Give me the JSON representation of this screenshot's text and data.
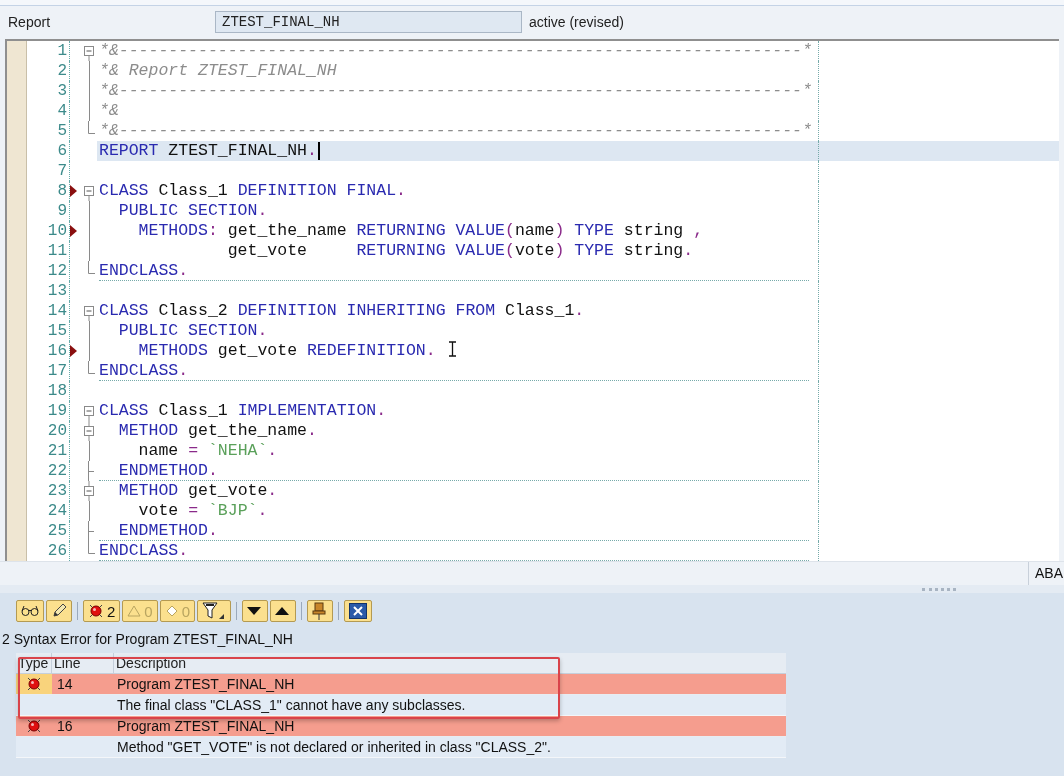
{
  "header": {
    "label": "Report",
    "program": "ZTEST_FINAL_NH",
    "status": "active (revised)"
  },
  "editor": {
    "lines": [
      {
        "number": "1",
        "kind": "open",
        "marker": false,
        "current": false,
        "rule": false,
        "tokens": [
          {
            "kind": "comment",
            "text": "*&---------------------------------------------------------------------*"
          }
        ]
      },
      {
        "number": "2",
        "kind": "line",
        "marker": false,
        "current": false,
        "rule": false,
        "tokens": [
          {
            "kind": "comment",
            "text": "*& Report ZTEST_FINAL_NH"
          }
        ]
      },
      {
        "number": "3",
        "kind": "line",
        "marker": false,
        "current": false,
        "rule": false,
        "tokens": [
          {
            "kind": "comment",
            "text": "*&---------------------------------------------------------------------*"
          }
        ]
      },
      {
        "number": "4",
        "kind": "line",
        "marker": false,
        "current": false,
        "rule": false,
        "tokens": [
          {
            "kind": "comment",
            "text": "*&"
          }
        ]
      },
      {
        "number": "5",
        "kind": "end",
        "marker": false,
        "current": false,
        "rule": false,
        "tokens": [
          {
            "kind": "comment",
            "text": "*&---------------------------------------------------------------------*"
          }
        ]
      },
      {
        "number": "6",
        "kind": "none",
        "marker": false,
        "current": true,
        "rule": false,
        "tokens": [
          {
            "kind": "keyword",
            "text": "REPORT"
          },
          {
            "kind": "ident",
            "text": " ZTEST_FINAL_NH"
          },
          {
            "kind": "punct",
            "text": "."
          }
        ]
      },
      {
        "number": "7",
        "kind": "none",
        "marker": false,
        "current": false,
        "rule": false
      },
      {
        "number": "8",
        "kind": "open",
        "marker": true,
        "current": false,
        "rule": false,
        "tokens": [
          {
            "kind": "keyword",
            "text": "CLASS"
          },
          {
            "kind": "ident",
            "text": " Class_1 "
          },
          {
            "kind": "keyword",
            "text": "DEFINITION FINAL"
          },
          {
            "kind": "punct",
            "text": "."
          }
        ]
      },
      {
        "number": "9",
        "kind": "line",
        "marker": false,
        "current": false,
        "rule": false,
        "tokens": [
          {
            "kind": "keyword",
            "text": "  PUBLIC SECTION"
          },
          {
            "kind": "punct",
            "text": "."
          }
        ]
      },
      {
        "number": "10",
        "kind": "line",
        "marker": true,
        "current": false,
        "rule": false,
        "tokens": [
          {
            "kind": "keyword",
            "text": "    METHODS"
          },
          {
            "kind": "punct",
            "text": ":"
          },
          {
            "kind": "ident",
            "text": " get_the_name "
          },
          {
            "kind": "keyword",
            "text": "RETURNING VALUE"
          },
          {
            "kind": "punct",
            "text": "("
          },
          {
            "kind": "ident",
            "text": "name"
          },
          {
            "kind": "punct",
            "text": ")"
          },
          {
            "kind": "keyword",
            "text": " TYPE"
          },
          {
            "kind": "ident",
            "text": " string "
          },
          {
            "kind": "punct",
            "text": ","
          }
        ]
      },
      {
        "number": "11",
        "kind": "line",
        "marker": false,
        "current": false,
        "rule": false,
        "tokens": [
          {
            "kind": "ident",
            "text": "             get_vote     "
          },
          {
            "kind": "keyword",
            "text": "RETURNING VALUE"
          },
          {
            "kind": "punct",
            "text": "("
          },
          {
            "kind": "ident",
            "text": "vote"
          },
          {
            "kind": "punct",
            "text": ")"
          },
          {
            "kind": "keyword",
            "text": " TYPE"
          },
          {
            "kind": "ident",
            "text": " string"
          },
          {
            "kind": "punct",
            "text": "."
          }
        ]
      },
      {
        "number": "12",
        "kind": "end",
        "marker": false,
        "current": false,
        "rule": true,
        "tokens": [
          {
            "kind": "keyword",
            "text": "ENDCLASS"
          },
          {
            "kind": "punct",
            "text": "."
          }
        ]
      },
      {
        "number": "13",
        "kind": "none",
        "marker": false,
        "current": false,
        "rule": false
      },
      {
        "number": "14",
        "kind": "open",
        "marker": false,
        "current": false,
        "rule": false,
        "tokens": [
          {
            "kind": "keyword",
            "text": "CLASS"
          },
          {
            "kind": "ident",
            "text": " Class_2 "
          },
          {
            "kind": "keyword",
            "text": "DEFINITION INHERITING FROM"
          },
          {
            "kind": "ident",
            "text": " Class_1"
          },
          {
            "kind": "punct",
            "text": "."
          }
        ]
      },
      {
        "number": "15",
        "kind": "line",
        "marker": false,
        "current": false,
        "rule": false,
        "tokens": [
          {
            "kind": "keyword",
            "text": "  PUBLIC SECTION"
          },
          {
            "kind": "punct",
            "text": "."
          }
        ]
      },
      {
        "number": "16",
        "kind": "line",
        "marker": true,
        "current": false,
        "rule": false,
        "tokens": [
          {
            "kind": "keyword",
            "text": "    METHODS"
          },
          {
            "kind": "ident",
            "text": " get_vote "
          },
          {
            "kind": "keyword",
            "text": "REDEFINITION"
          },
          {
            "kind": "punct",
            "text": "."
          }
        ]
      },
      {
        "number": "17",
        "kind": "end",
        "marker": false,
        "current": false,
        "rule": true,
        "tokens": [
          {
            "kind": "keyword",
            "text": "ENDCLASS"
          },
          {
            "kind": "punct",
            "text": "."
          }
        ]
      },
      {
        "number": "18",
        "kind": "none",
        "marker": false,
        "current": false,
        "rule": false
      },
      {
        "number": "19",
        "kind": "open",
        "marker": false,
        "current": false,
        "rule": false,
        "tokens": [
          {
            "kind": "keyword",
            "text": "CLASS"
          },
          {
            "kind": "ident",
            "text": " Class_1 "
          },
          {
            "kind": "keyword",
            "text": "IMPLEMENTATION"
          },
          {
            "kind": "punct",
            "text": "."
          }
        ]
      },
      {
        "number": "20",
        "kind": "nested",
        "marker": false,
        "current": false,
        "rule": false,
        "tokens": [
          {
            "kind": "keyword",
            "text": "  METHOD"
          },
          {
            "kind": "ident",
            "text": " get_the_name"
          },
          {
            "kind": "punct",
            "text": "."
          }
        ]
      },
      {
        "number": "21",
        "kind": "line",
        "marker": false,
        "current": false,
        "rule": false,
        "tokens": [
          {
            "kind": "ident",
            "text": "    name "
          },
          {
            "kind": "punct",
            "text": "="
          },
          {
            "kind": "string",
            "text": " `NEHA`"
          },
          {
            "kind": "punct",
            "text": "."
          }
        ]
      },
      {
        "number": "22",
        "kind": "tee",
        "marker": false,
        "current": false,
        "rule": true,
        "tokens": [
          {
            "kind": "keyword",
            "text": "  ENDMETHOD"
          },
          {
            "kind": "punct",
            "text": "."
          }
        ]
      },
      {
        "number": "23",
        "kind": "nested",
        "marker": false,
        "current": false,
        "rule": false,
        "tokens": [
          {
            "kind": "keyword",
            "text": "  METHOD"
          },
          {
            "kind": "ident",
            "text": " get_vote"
          },
          {
            "kind": "punct",
            "text": "."
          }
        ]
      },
      {
        "number": "24",
        "kind": "line",
        "marker": false,
        "current": false,
        "rule": false,
        "tokens": [
          {
            "kind": "ident",
            "text": "    vote "
          },
          {
            "kind": "punct",
            "text": "="
          },
          {
            "kind": "string",
            "text": " `BJP`"
          },
          {
            "kind": "punct",
            "text": "."
          }
        ]
      },
      {
        "number": "25",
        "kind": "tee",
        "marker": false,
        "current": false,
        "rule": true,
        "tokens": [
          {
            "kind": "keyword",
            "text": "  ENDMETHOD"
          },
          {
            "kind": "punct",
            "text": "."
          }
        ]
      },
      {
        "number": "26",
        "kind": "end",
        "marker": false,
        "current": false,
        "rule": true,
        "tokens": [
          {
            "kind": "keyword",
            "text": "ENDCLASS"
          },
          {
            "kind": "punct",
            "text": "."
          }
        ]
      }
    ]
  },
  "status_bar": {
    "language": "ABA"
  },
  "toolbar": [
    {
      "kind": "display"
    },
    {
      "kind": "edit"
    },
    {
      "kind": "errors",
      "count": "2"
    },
    {
      "kind": "warnings",
      "count": "0"
    },
    {
      "kind": "infos",
      "count": "0"
    },
    {
      "kind": "filter"
    },
    {
      "kind": "next"
    },
    {
      "kind": "previous"
    },
    {
      "kind": "pin"
    },
    {
      "kind": "close"
    }
  ],
  "messages_title": "2 Syntax Error for Program ZTEST_FINAL_NH",
  "table": {
    "columns": [
      "Type",
      "Line",
      "Description"
    ],
    "rows": [
      {
        "kind": "error",
        "line": "14",
        "program": "Program ZTEST_FINAL_NH",
        "text": "The final class \"CLASS_1\" cannot have any subclasses.",
        "selected": true
      },
      {
        "kind": "error",
        "line": "16",
        "program": "Program ZTEST_FINAL_NH",
        "text": "Method \"GET_VOTE\" is not declared or inherited in class \"CLASS_2\".",
        "selected": false
      }
    ]
  }
}
